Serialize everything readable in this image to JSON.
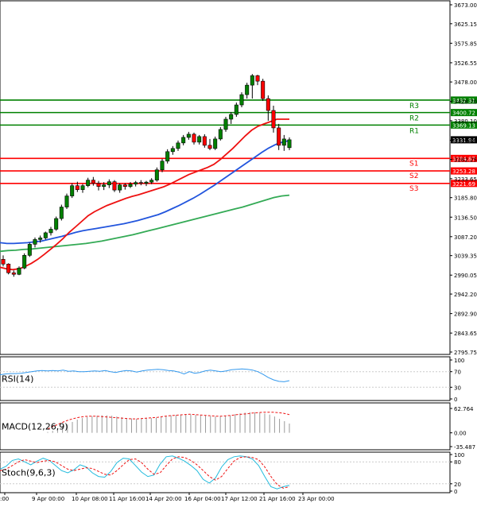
{
  "chart_data": {
    "type": "candlestick",
    "price_panel": {
      "y_ticks": [
        "3673.00",
        "3625.15",
        "3575.85",
        "3526.55",
        "3478.00",
        "3428.70",
        "3380.10",
        "3330.80",
        "3282.25",
        "3233.65",
        "3185.80",
        "3136.50",
        "3087.20",
        "3039.35",
        "2990.05",
        "2942.20",
        "2892.90",
        "2843.65",
        "2795.75"
      ],
      "ylim": [
        2795.75,
        3673.0
      ],
      "candles": [
        {
          "o": 3030,
          "h": 3040,
          "l": 3012,
          "c": 3018
        },
        {
          "o": 3018,
          "h": 3020,
          "l": 2992,
          "c": 2996
        },
        {
          "o": 2996,
          "h": 3002,
          "l": 2986,
          "c": 2992
        },
        {
          "o": 2992,
          "h": 3012,
          "l": 2990,
          "c": 3008
        },
        {
          "o": 3008,
          "h": 3045,
          "l": 3005,
          "c": 3040
        },
        {
          "o": 3040,
          "h": 3072,
          "l": 3036,
          "c": 3068
        },
        {
          "o": 3068,
          "h": 3085,
          "l": 3060,
          "c": 3080
        },
        {
          "o": 3080,
          "h": 3090,
          "l": 3072,
          "c": 3084
        },
        {
          "o": 3084,
          "h": 3100,
          "l": 3080,
          "c": 3097
        },
        {
          "o": 3097,
          "h": 3112,
          "l": 3090,
          "c": 3106
        },
        {
          "o": 3106,
          "h": 3138,
          "l": 3102,
          "c": 3133
        },
        {
          "o": 3133,
          "h": 3168,
          "l": 3128,
          "c": 3162
        },
        {
          "o": 3162,
          "h": 3196,
          "l": 3157,
          "c": 3190
        },
        {
          "o": 3190,
          "h": 3222,
          "l": 3185,
          "c": 3216
        },
        {
          "o": 3216,
          "h": 3226,
          "l": 3200,
          "c": 3206
        },
        {
          "o": 3206,
          "h": 3220,
          "l": 3198,
          "c": 3216
        },
        {
          "o": 3216,
          "h": 3236,
          "l": 3212,
          "c": 3230
        },
        {
          "o": 3230,
          "h": 3238,
          "l": 3216,
          "c": 3222
        },
        {
          "o": 3222,
          "h": 3228,
          "l": 3204,
          "c": 3214
        },
        {
          "o": 3214,
          "h": 3225,
          "l": 3205,
          "c": 3218
        },
        {
          "o": 3218,
          "h": 3232,
          "l": 3210,
          "c": 3226
        },
        {
          "o": 3226,
          "h": 3230,
          "l": 3200,
          "c": 3205
        },
        {
          "o": 3205,
          "h": 3222,
          "l": 3198,
          "c": 3218
        },
        {
          "o": 3218,
          "h": 3222,
          "l": 3206,
          "c": 3214
        },
        {
          "o": 3214,
          "h": 3225,
          "l": 3210,
          "c": 3220
        },
        {
          "o": 3220,
          "h": 3228,
          "l": 3214,
          "c": 3224
        },
        {
          "o": 3224,
          "h": 3230,
          "l": 3217,
          "c": 3222
        },
        {
          "o": 3222,
          "h": 3228,
          "l": 3215,
          "c": 3225
        },
        {
          "o": 3225,
          "h": 3235,
          "l": 3220,
          "c": 3230
        },
        {
          "o": 3230,
          "h": 3262,
          "l": 3226,
          "c": 3256
        },
        {
          "o": 3256,
          "h": 3284,
          "l": 3250,
          "c": 3278
        },
        {
          "o": 3278,
          "h": 3308,
          "l": 3272,
          "c": 3302
        },
        {
          "o": 3302,
          "h": 3316,
          "l": 3294,
          "c": 3310
        },
        {
          "o": 3310,
          "h": 3330,
          "l": 3304,
          "c": 3324
        },
        {
          "o": 3324,
          "h": 3344,
          "l": 3318,
          "c": 3338
        },
        {
          "o": 3338,
          "h": 3352,
          "l": 3332,
          "c": 3346
        },
        {
          "o": 3346,
          "h": 3350,
          "l": 3320,
          "c": 3326
        },
        {
          "o": 3326,
          "h": 3344,
          "l": 3320,
          "c": 3340
        },
        {
          "o": 3340,
          "h": 3346,
          "l": 3312,
          "c": 3318
        },
        {
          "o": 3318,
          "h": 3334,
          "l": 3306,
          "c": 3310
        },
        {
          "o": 3310,
          "h": 3340,
          "l": 3306,
          "c": 3334
        },
        {
          "o": 3334,
          "h": 3364,
          "l": 3330,
          "c": 3358
        },
        {
          "o": 3358,
          "h": 3390,
          "l": 3352,
          "c": 3384
        },
        {
          "o": 3384,
          "h": 3402,
          "l": 3372,
          "c": 3396
        },
        {
          "o": 3396,
          "h": 3426,
          "l": 3390,
          "c": 3420
        },
        {
          "o": 3420,
          "h": 3452,
          "l": 3414,
          "c": 3446
        },
        {
          "o": 3446,
          "h": 3476,
          "l": 3436,
          "c": 3470
        },
        {
          "o": 3470,
          "h": 3498,
          "l": 3436,
          "c": 3494
        },
        {
          "o": 3494,
          "h": 3496,
          "l": 3470,
          "c": 3480
        },
        {
          "o": 3480,
          "h": 3486,
          "l": 3430,
          "c": 3436
        },
        {
          "o": 3436,
          "h": 3444,
          "l": 3380,
          "c": 3406
        },
        {
          "o": 3406,
          "h": 3418,
          "l": 3350,
          "c": 3362
        },
        {
          "o": 3362,
          "h": 3372,
          "l": 3306,
          "c": 3318
        },
        {
          "o": 3318,
          "h": 3344,
          "l": 3304,
          "c": 3334
        },
        {
          "o": 3312,
          "h": 3338,
          "l": 3306,
          "c": 3332
        }
      ],
      "ma_fast": [
        3010,
        3006,
        3004,
        3006,
        3012,
        3020,
        3030,
        3042,
        3055,
        3068,
        3082,
        3098,
        3112,
        3126,
        3140,
        3150,
        3158,
        3166,
        3172,
        3178,
        3184,
        3189,
        3193,
        3198,
        3203,
        3208,
        3213,
        3220,
        3228,
        3236,
        3244,
        3250,
        3256,
        3262,
        3270,
        3282,
        3296,
        3310,
        3326,
        3342,
        3356,
        3366,
        3372,
        3378,
        3384,
        3384,
        3384
      ],
      "ma_mid": [
        3072,
        3070,
        3070,
        3071,
        3072,
        3074,
        3076,
        3080,
        3084,
        3088,
        3093,
        3098,
        3102,
        3105,
        3108,
        3111,
        3114,
        3117,
        3120,
        3124,
        3128,
        3133,
        3138,
        3143,
        3150,
        3158,
        3166,
        3175,
        3184,
        3194,
        3205,
        3216,
        3228,
        3240,
        3252,
        3264,
        3276,
        3288,
        3300,
        3311,
        3320,
        3326,
        3330
      ],
      "ma_slow": [
        3050,
        3052,
        3053,
        3055,
        3056,
        3058,
        3060,
        3062,
        3064,
        3066,
        3068,
        3070,
        3073,
        3076,
        3080,
        3084,
        3088,
        3092,
        3097,
        3102,
        3107,
        3112,
        3117,
        3122,
        3127,
        3132,
        3137,
        3142,
        3147,
        3152,
        3157,
        3162,
        3168,
        3174,
        3180,
        3186,
        3190,
        3192
      ],
      "levels": [
        {
          "name": "R3",
          "value": "3432.31",
          "color": "#008000"
        },
        {
          "name": "R2",
          "value": "3400.72",
          "color": "#008000"
        },
        {
          "name": "R1",
          "value": "3369.13",
          "color": "#008000"
        },
        {
          "name": "S1",
          "value": "3284.87",
          "color": "#ff0000"
        },
        {
          "name": "S2",
          "value": "3253.28",
          "color": "#ff0000"
        },
        {
          "name": "S3",
          "value": "3221.69",
          "color": "#ff0000"
        }
      ],
      "current_price": "3331.94"
    },
    "rsi_panel": {
      "label": "RSI(14)",
      "y_ticks": [
        "100",
        "70",
        "30",
        "0"
      ],
      "ylim": [
        0,
        100
      ],
      "values": [
        62,
        64,
        65,
        65,
        66,
        68,
        70,
        72,
        73,
        72,
        73,
        72,
        74,
        71,
        72,
        70,
        70,
        71,
        72,
        71,
        73,
        70,
        68,
        71,
        73,
        72,
        69,
        72,
        74,
        75,
        76,
        75,
        73,
        72,
        69,
        64,
        70,
        66,
        68,
        72,
        74,
        72,
        70,
        72,
        75,
        76,
        77,
        76,
        74,
        70,
        63,
        55,
        49,
        45,
        44,
        47
      ]
    },
    "macd_panel": {
      "label": "MACD(12,26,9)",
      "y_ticks": [
        "62.764",
        "0.00",
        "-35.487"
      ],
      "ylim": [
        -35.487,
        62.764
      ],
      "histogram": [
        2,
        5,
        10,
        16,
        22,
        28,
        34,
        38,
        41,
        43,
        44,
        45,
        45,
        44,
        42,
        40,
        38,
        37,
        36,
        36,
        37,
        38,
        39,
        41,
        43,
        45,
        46,
        47,
        48,
        47,
        46,
        45,
        44,
        43,
        42,
        42,
        43,
        45,
        48,
        50,
        52,
        53,
        53,
        52,
        50,
        47,
        42,
        36,
        30,
        24
      ],
      "signal": [
        10,
        16,
        22,
        28,
        33,
        37,
        40,
        42,
        43,
        43,
        42,
        41,
        40,
        39,
        38,
        37,
        36,
        36,
        37,
        38,
        39,
        40,
        42,
        44,
        45,
        46,
        47,
        48,
        47,
        46,
        45,
        44,
        43,
        43,
        44,
        45,
        47,
        48,
        49,
        51,
        52,
        53,
        53,
        53,
        52,
        50,
        47
      ]
    },
    "stoch_panel": {
      "label": "Stoch(9,6,3)",
      "y_ticks": [
        "100",
        "80",
        "20",
        "0"
      ],
      "ylim": [
        0,
        100
      ],
      "main": [
        60,
        68,
        84,
        88,
        80,
        72,
        82,
        90,
        84,
        70,
        56,
        50,
        58,
        72,
        66,
        50,
        40,
        38,
        54,
        78,
        90,
        88,
        70,
        52,
        40,
        44,
        74,
        94,
        96,
        90,
        82,
        70,
        56,
        32,
        22,
        36,
        66,
        86,
        94,
        96,
        94,
        88,
        70,
        40,
        12,
        6,
        12,
        16
      ],
      "signal": [
        56,
        60,
        70,
        80,
        86,
        82,
        78,
        82,
        84,
        80,
        70,
        60,
        56,
        60,
        64,
        62,
        54,
        46,
        44,
        56,
        72,
        86,
        88,
        78,
        60,
        46,
        50,
        70,
        88,
        94,
        92,
        84,
        72,
        56,
        40,
        30,
        40,
        62,
        82,
        92,
        94,
        92,
        86,
        66,
        40,
        18,
        8,
        12
      ]
    },
    "x_labels": [
      ":00",
      "9 Apr 00:00",
      "10 Apr 08:00",
      "11 Apr 16:00",
      "14 Apr 20:00",
      "16 Apr 04:00",
      "17 Apr 12:00",
      "21 Apr 16:00",
      "23 Apr 00:00"
    ],
    "colors": {
      "up_candle": "#008000",
      "down_candle": "#ff0000",
      "ma_fast": "#ee1111",
      "ma_mid": "#2255dd",
      "ma_slow": "#33aa55",
      "rsi_line": "#3399ee",
      "macd_hist": "#999999",
      "macd_signal": "#ee1111",
      "stoch_main": "#22bbdd",
      "stoch_signal": "#ee1111"
    }
  }
}
